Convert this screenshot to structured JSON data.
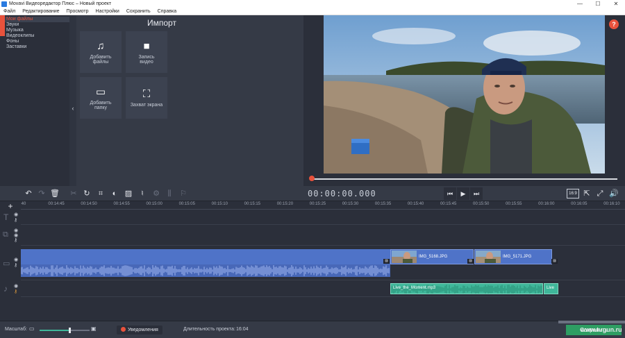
{
  "window": {
    "title": "Movavi Видеоредактор Плюс – Новый проект",
    "controls": [
      "—",
      "☐",
      "✕"
    ]
  },
  "menu": [
    "Файл",
    "Редактирование",
    "Просмотр",
    "Настройки",
    "Сохранить",
    "Справка"
  ],
  "import_panel": {
    "title": "Импорт",
    "categories": [
      "Мои файлы",
      "Звуки",
      "Музыка",
      "Видеоклипы",
      "Фоны",
      "Заставки"
    ],
    "selected_category": "Мои файлы",
    "tiles": [
      {
        "line1": "Добавить",
        "line2": "файлы",
        "icon": "add-files-icon"
      },
      {
        "line1": "Запись",
        "line2": "видео",
        "icon": "record-video-icon"
      },
      {
        "line1": "Добавить",
        "line2": "папку",
        "icon": "add-folder-icon"
      },
      {
        "line1": "Захват экрана",
        "line2": "",
        "icon": "screen-capture-icon"
      }
    ]
  },
  "player": {
    "timecode": "00:00:00.000",
    "aspect_ratio": "16:9",
    "help": "?"
  },
  "ruler_ticks": [
    "40",
    "00:14:45",
    "00:14:50",
    "00:14:55",
    "00:15:00",
    "00:15:05",
    "00:15:10",
    "00:15:15",
    "00:15:20",
    "00:15:25",
    "00:15:30",
    "00:15:35",
    "00:15:40",
    "00:15:45",
    "00:15:50",
    "00:15:55",
    "00:16:00",
    "00:16:05",
    "00:16:10"
  ],
  "timeline": {
    "image_clips": [
      "IMG_5168.JPG",
      "IMG_5171.JPG"
    ],
    "music_clips": [
      "Live_the_Moment.mp3",
      "Live"
    ]
  },
  "status": {
    "zoom_label": "Масштаб:",
    "zoom_level": 0.6,
    "notifications": "Уведомления",
    "duration_label": "Длительность проекта:",
    "duration_value": "16:04",
    "export_label": "Сохранить"
  },
  "watermark": "www.tugun.ru"
}
